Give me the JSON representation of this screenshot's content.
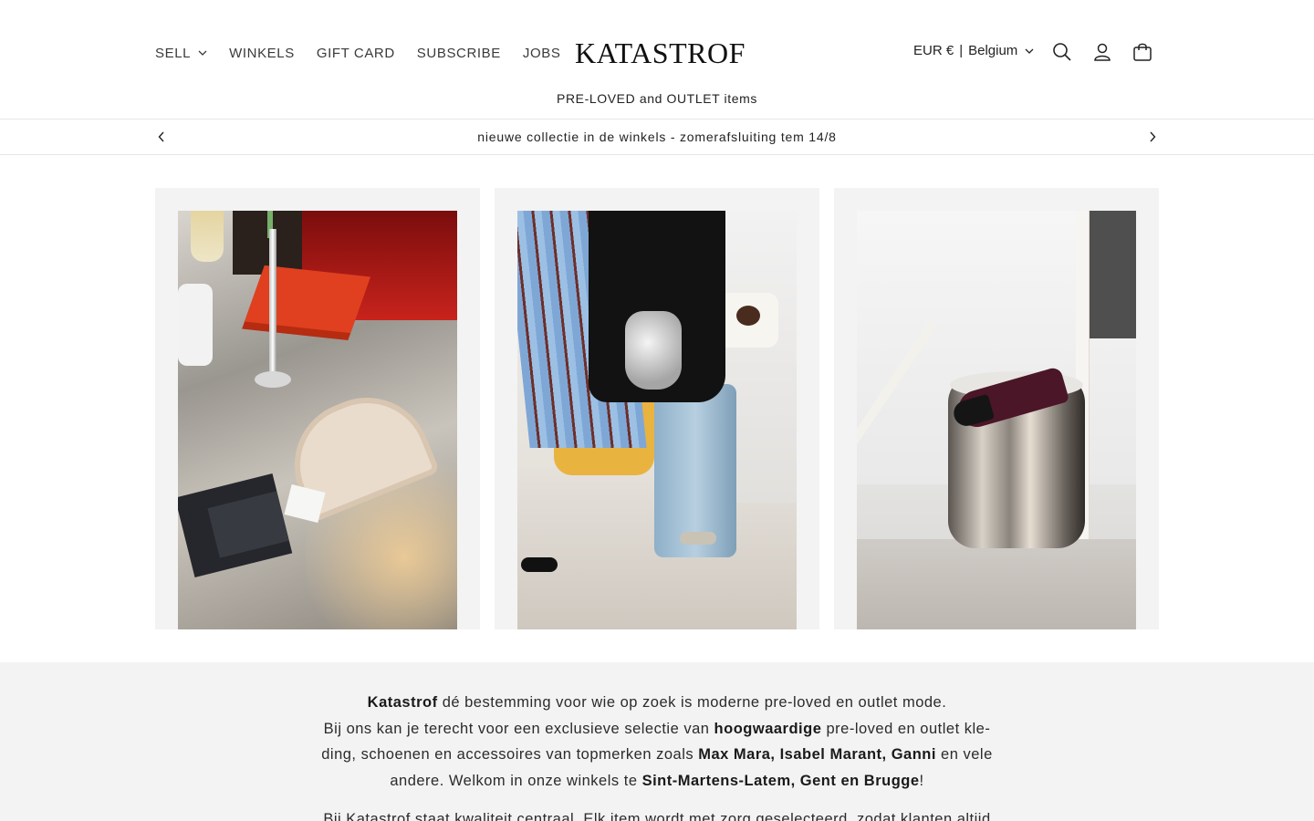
{
  "header": {
    "nav": [
      {
        "label": "SELL",
        "has_dropdown": true
      },
      {
        "label": "WINKELS",
        "has_dropdown": false
      },
      {
        "label": "GIFT CARD",
        "has_dropdown": false
      },
      {
        "label": "SUBSCRIBE",
        "has_dropdown": false
      },
      {
        "label": "JOBS",
        "has_dropdown": false
      }
    ],
    "logo": "KATASTROF",
    "subtitle": "PRE-LOVED and OUTLET items",
    "localization": {
      "currency": "EUR €",
      "separator": "|",
      "country": "Belgium"
    },
    "icons": [
      "search-icon",
      "account-icon",
      "cart-icon"
    ]
  },
  "announcement": {
    "text": "nieuwe collectie in de winkels - zomerafsluiting tem 14/8",
    "prev_icon": "chevron-left-icon",
    "next_icon": "chevron-right-icon"
  },
  "gallery": {
    "items": [
      {
        "subject": "table with red box and ring box"
      },
      {
        "subject": "clothing rack with striped shirt and silver bag"
      },
      {
        "subject": "burgundy slingback shoes on chrome stool"
      }
    ]
  },
  "about": {
    "p1": {
      "brand": "Katastrof",
      "t1": " dé bestemming voor wie op zoek is moderne pre-loved en outlet mode.",
      "t2": "Bij ons kan je terecht voor een exclusieve selectie van ",
      "b1": "hoogwaardige",
      "t3": " pre-loved en outlet kle-",
      "t4": "ding, schoenen en accessoires van topmerken zoals ",
      "b2": "Max Mara, Isabel Marant, Ganni",
      "t5": " en vele",
      "t6": "andere. Welkom in onze winkels te ",
      "b3": "Sint-Martens-Latem, Gent en Brugge",
      "t7": "!"
    },
    "p2": "Bij Katastrof staat kwaliteit centraal. Elk item wordt met zorg geselecteerd, zodat klanten altijd"
  }
}
